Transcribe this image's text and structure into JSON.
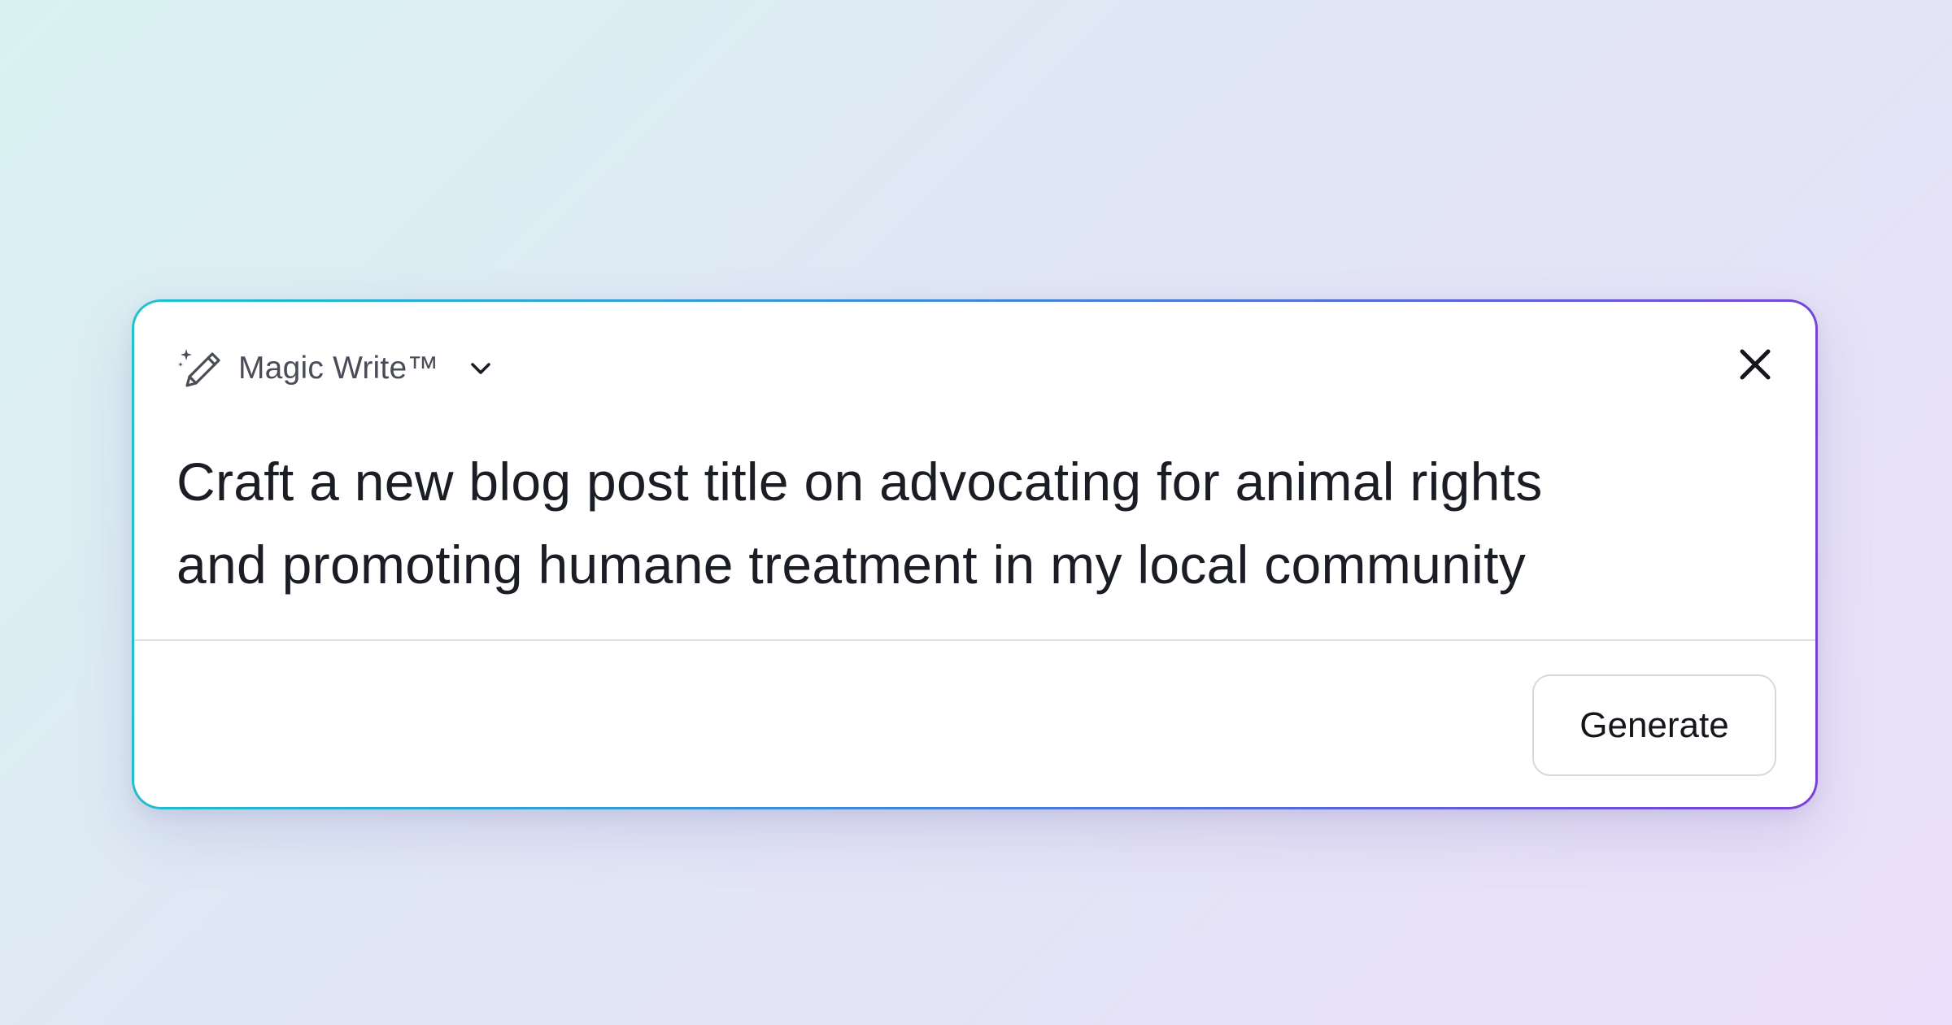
{
  "widget": {
    "mode_label": "Magic Write™",
    "prompt_lines": [
      "Craft a new blog post title on advocating for animal rights",
      "and promoting humane treatment in my local community"
    ],
    "generate_label": "Generate"
  },
  "icons": {
    "mode": "magic-wand-sparkle-icon",
    "dropdown": "chevron-down-icon",
    "close": "close-icon"
  },
  "colors": {
    "border_gradient": [
      "#1fc3cc",
      "#3c8ad9",
      "#5a62db",
      "#7b3fd8"
    ],
    "text": "#1a1d24",
    "label": "#4a4d57"
  }
}
